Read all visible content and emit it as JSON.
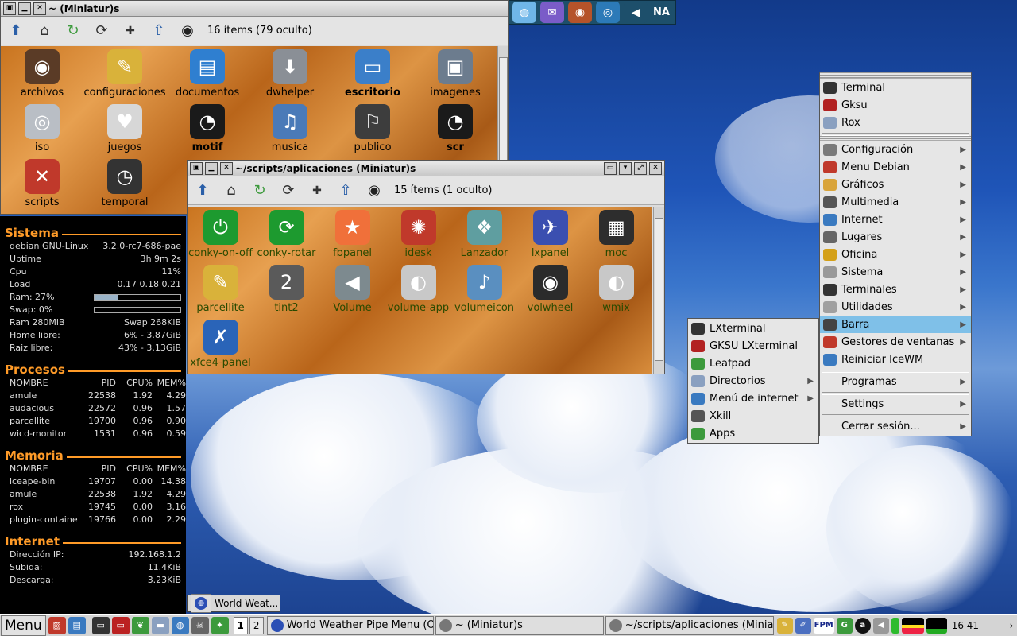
{
  "dock": {
    "label": "NA"
  },
  "win_home": {
    "title": "~ (Miniatur)s",
    "count": "16 ítems (79 oculto)",
    "items": [
      {
        "label": "archivos",
        "bold": false,
        "color": "#5a3b26",
        "glyph": "◉"
      },
      {
        "label": "configuraciones",
        "bold": false,
        "color": "#d9b23a",
        "glyph": "✎"
      },
      {
        "label": "documentos",
        "bold": false,
        "color": "#2f7fd0",
        "glyph": "▤"
      },
      {
        "label": "dwhelper",
        "bold": false,
        "color": "#8a8f96",
        "glyph": "⬇"
      },
      {
        "label": "escritorio",
        "bold": true,
        "color": "#3b7fc9",
        "glyph": "▭"
      },
      {
        "label": "imagenes",
        "bold": false,
        "color": "#6c7c8e",
        "glyph": "▣"
      },
      {
        "label": "iso",
        "bold": false,
        "color": "#b9bec5",
        "glyph": "◎"
      },
      {
        "label": "juegos",
        "bold": false,
        "color": "#d7d7d7",
        "glyph": "♥"
      },
      {
        "label": "motif",
        "bold": true,
        "color": "#1a1a1a",
        "glyph": "◔"
      },
      {
        "label": "musica",
        "bold": false,
        "color": "#4a7ab8",
        "glyph": "♫"
      },
      {
        "label": "publico",
        "bold": false,
        "color": "#3d3d3d",
        "glyph": "⚐"
      },
      {
        "label": "scr",
        "bold": true,
        "color": "#1a1a1a",
        "glyph": "◔"
      },
      {
        "label": "scripts",
        "bold": false,
        "color": "#c0392b",
        "glyph": "✕"
      },
      {
        "label": "temporal",
        "bold": false,
        "color": "#333333",
        "glyph": "◷"
      }
    ]
  },
  "win_scripts": {
    "title": "~/scripts/aplicaciones (Miniatur)s",
    "count": "15 ítems (1 oculto)",
    "items": [
      {
        "label": "conky-on-off",
        "color": "#1d9a2f",
        "glyph": "⏻"
      },
      {
        "label": "conky-rotar",
        "color": "#1d9a2f",
        "glyph": "⟳"
      },
      {
        "label": "fbpanel",
        "color": "#f0703a",
        "glyph": "★"
      },
      {
        "label": "idesk",
        "color": "#c0392b",
        "glyph": "✺"
      },
      {
        "label": "Lanzador",
        "color": "#5f9ea0",
        "glyph": "❖"
      },
      {
        "label": "lxpanel",
        "color": "#3b4fb0",
        "glyph": "✈"
      },
      {
        "label": "moc",
        "color": "#2d2d2d",
        "glyph": "▦"
      },
      {
        "label": "parcellite",
        "color": "#d9b23a",
        "glyph": "✎"
      },
      {
        "label": "tint2",
        "color": "#5a5a5a",
        "glyph": "2"
      },
      {
        "label": "Volume",
        "color": "#7d8a8f",
        "glyph": "◀"
      },
      {
        "label": "volume-app",
        "color": "#c8c8c8",
        "glyph": "◐"
      },
      {
        "label": "volumeicon",
        "color": "#5a8fc0",
        "glyph": "♪"
      },
      {
        "label": "volwheel",
        "color": "#2b2b2b",
        "glyph": "◉"
      },
      {
        "label": "wmix",
        "color": "#c8c8c8",
        "glyph": "◐"
      },
      {
        "label": "xfce4-panel",
        "color": "#2a64b8",
        "glyph": "✗"
      }
    ]
  },
  "conky": {
    "sistema": {
      "title": "Sistema",
      "rows": [
        [
          "debian GNU-Linux",
          "3.2.0-rc7-686-pae"
        ],
        [
          "Uptime",
          "3h 9m 2s"
        ],
        [
          "Cpu",
          "11%"
        ],
        [
          "Load",
          "0.17 0.18 0.21"
        ]
      ],
      "ram_label": "Ram:  27%",
      "ram_fraction": 0.27,
      "swap_label": "Swap: 0%",
      "swap_fraction": 0,
      "rows2": [
        [
          "Ram 280MiB",
          "Swap 268KiB"
        ],
        [
          "Home libre:",
          "6% - 3.87GiB"
        ],
        [
          "Raiz libre:",
          "43% - 3.13GiB"
        ]
      ]
    },
    "procesos": {
      "title": "Procesos",
      "header": [
        "NOMBRE",
        "PID",
        "CPU%",
        "MEM%"
      ],
      "rows": [
        [
          "amule",
          "22538",
          "1.92",
          "4.29"
        ],
        [
          "audacious",
          "22572",
          "0.96",
          "1.57"
        ],
        [
          "parcellite",
          "19700",
          "0.96",
          "0.90"
        ],
        [
          "wicd-monitor",
          "1531",
          "0.96",
          "0.59"
        ]
      ]
    },
    "memoria": {
      "title": "Memoria",
      "header": [
        "NOMBRE",
        "PID",
        "CPU%",
        "MEM%"
      ],
      "rows": [
        [
          "iceape-bin",
          "19707",
          "0.00",
          "14.38"
        ],
        [
          "amule",
          "22538",
          "1.92",
          "4.29"
        ],
        [
          "rox",
          "19745",
          "0.00",
          "3.16"
        ],
        [
          "plugin-containe",
          "19766",
          "0.00",
          "2.29"
        ]
      ]
    },
    "internet": {
      "title": "Internet",
      "rows": [
        [
          "Dirección IP:",
          "192.168.1.2"
        ],
        [
          "Subida:",
          "11.4KiB"
        ],
        [
          "Descarga:",
          "3.23KiB"
        ]
      ]
    }
  },
  "main_menu": {
    "top": [
      {
        "label": "Terminal",
        "u": "T",
        "color": "#333333"
      },
      {
        "label": "Gksu",
        "u": "G",
        "color": "#b22222"
      },
      {
        "label": "Rox",
        "u": "R",
        "color": "#8aa0c0"
      }
    ],
    "items": [
      {
        "label": "Configuración",
        "color": "#7a7a7a"
      },
      {
        "label": "Menu Debian",
        "color": "#c0392b"
      },
      {
        "label": "Gráficos",
        "color": "#d9a43a"
      },
      {
        "label": "Multimedia",
        "color": "#555555"
      },
      {
        "label": "Internet",
        "color": "#3a7ac0"
      },
      {
        "label": "Lugares",
        "color": "#666666"
      },
      {
        "label": "Oficina",
        "color": "#d4a017"
      },
      {
        "label": "Sistema",
        "color": "#999999"
      },
      {
        "label": "Terminales",
        "color": "#333333"
      },
      {
        "label": "Utilidades",
        "color": "#a0a0a0"
      },
      {
        "label": "Barra",
        "color": "#444444"
      },
      {
        "label": "Gestores de ventanas",
        "color": "#c0392b"
      },
      {
        "label": "Reiniciar IceWM",
        "color": "#3a7ac0"
      }
    ],
    "bottom": [
      {
        "label": "Programas"
      },
      {
        "label": "Settings"
      },
      {
        "label": "Cerrar sesión..."
      }
    ]
  },
  "sub_menu": {
    "items": [
      {
        "label": "LXterminal",
        "color": "#333333",
        "arrow": false
      },
      {
        "label": "GKSU LXterminal",
        "color": "#b22222",
        "arrow": false
      },
      {
        "label": "Leafpad",
        "color": "#3c9a3c",
        "arrow": false
      },
      {
        "label": "Directorios",
        "color": "#8aa0c0",
        "arrow": true
      },
      {
        "label": "Menú de internet",
        "color": "#3a7ac0",
        "arrow": true
      },
      {
        "label": "Xkill",
        "color": "#555555",
        "arrow": false
      },
      {
        "label": "Apps",
        "color": "#3c9a3c",
        "arrow": false
      }
    ]
  },
  "mini_window": {
    "label": "World Weat..."
  },
  "taskbar": {
    "menu_label": "Menu",
    "workspaces": [
      "1",
      "2"
    ],
    "tasks": [
      {
        "label": "World Weather Pipe Menu (Op..."
      },
      {
        "label": "~ (Miniatur)s"
      },
      {
        "label": "~/scripts/aplicaciones (Miniatu..."
      }
    ],
    "tray_fpm": "FPM",
    "clock": "16 41"
  }
}
